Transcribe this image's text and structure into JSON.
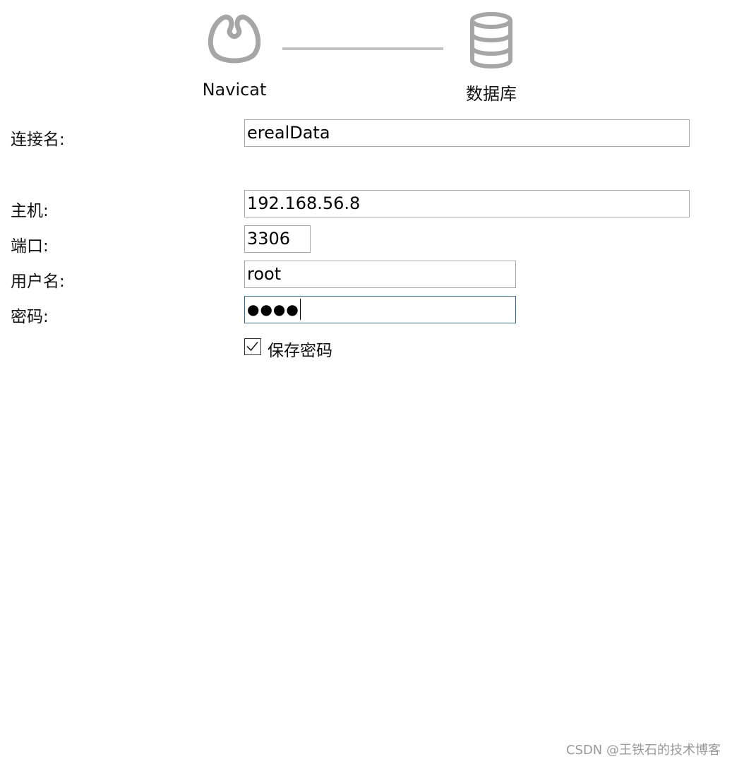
{
  "header": {
    "left_label": "Navicat",
    "right_label": "数据库",
    "left_icon": "navicat-logo-icon",
    "right_icon": "database-icon",
    "icon_color": "#a6a6a6"
  },
  "form": {
    "connection_name": {
      "label": "连接名:",
      "value": "erealData"
    },
    "host": {
      "label": "主机:",
      "value": "192.168.56.8"
    },
    "port": {
      "label": "端口:",
      "value": "3306"
    },
    "username": {
      "label": "用户名:",
      "value": "root"
    },
    "password": {
      "label": "密码:",
      "masked_value": "●●●●"
    },
    "save_password": {
      "label": "保存密码",
      "checked": true
    }
  },
  "watermark": "CSDN @王铁石的技术博客"
}
